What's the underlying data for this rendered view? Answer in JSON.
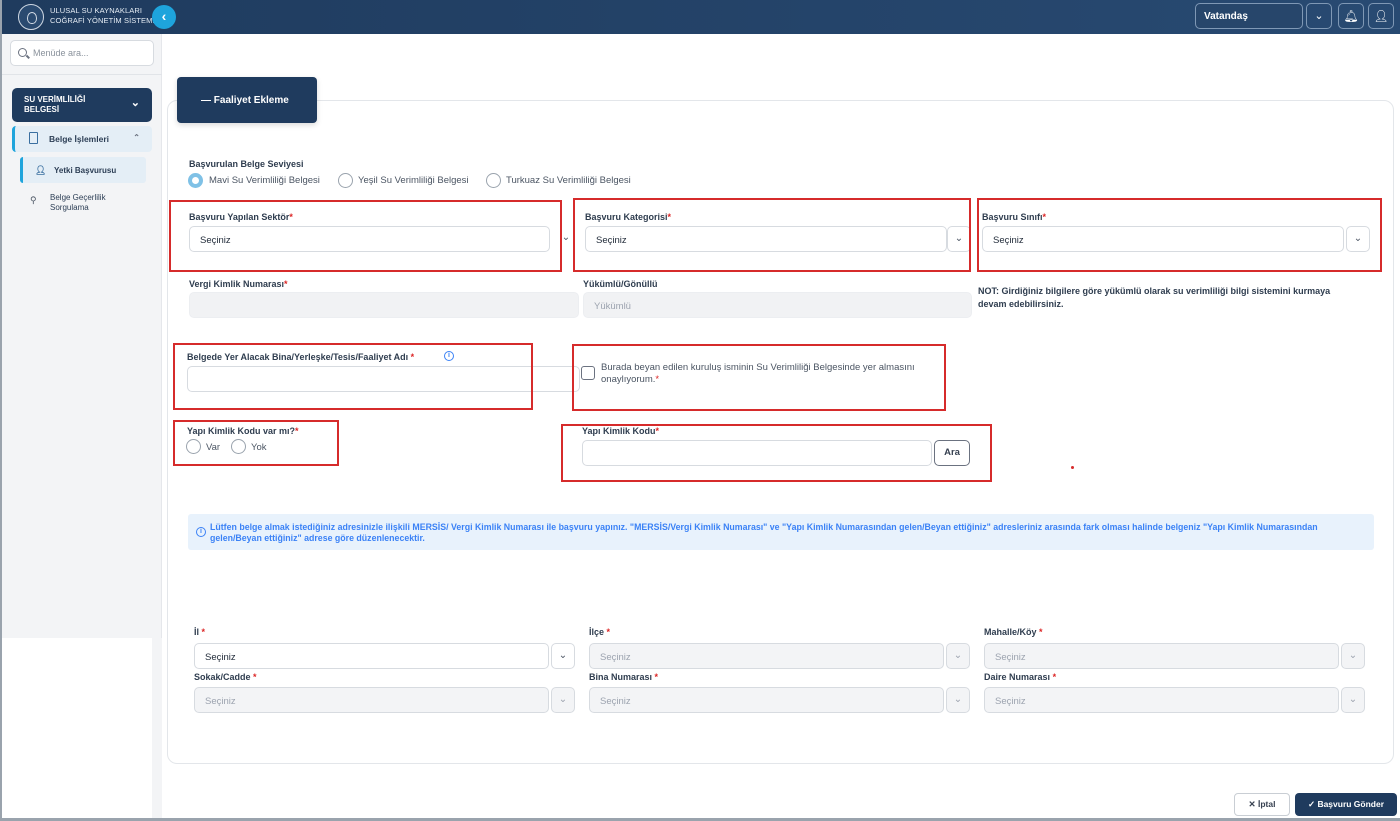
{
  "header": {
    "brand_line1": "ULUSAL SU KAYNAKLARI",
    "brand_line2": "COĞRAFİ YÖNETİM SİSTEMİ",
    "role": "Vatandaş"
  },
  "sidebar": {
    "search_placeholder": "Menüde ara...",
    "main_menu_line1": "SU VERİMLİLİĞİ",
    "main_menu_line2": "BELGESİ",
    "sub_menu": "Belge İşlemleri",
    "items": [
      {
        "label": "Yetki Başvurusu"
      },
      {
        "label_line1": "Belge Geçerlilik",
        "label_line2": "Sorgulama"
      }
    ]
  },
  "form": {
    "tab_title": "— Faaliyet Ekleme",
    "belge_seviyesi_label": "Başvurulan Belge Seviyesi",
    "belge_options": [
      "Mavi Su Verimliliği Belgesi",
      "Yeşil Su Verimliliği Belgesi",
      "Turkuaz Su Verimliliği Belgesi"
    ],
    "sektor_label": "Başvuru Yapılan Sektör",
    "kategori_label": "Başvuru Kategorisi",
    "sinif_label": "Başvuru Sınıfı",
    "select_default": "Seçiniz",
    "vkn_label": "Vergi Kimlik Numarası",
    "yukumlu_label": "Yükümlü/Gönüllü",
    "yukumlu_value": "Yükümlü",
    "note": "NOT: Girdiğiniz bilgilere göre yükümlü olarak su verimliliği bilgi sistemini kurmaya devam edebilirsiniz.",
    "bina_label": "Belgede Yer Alacak Bina/Yerleşke/Tesis/Faaliyet Adı",
    "onay_text": "Burada beyan edilen kuruluş isminin Su Verimliliği Belgesinde yer almasını onaylıyorum.",
    "ykk_var_label": "Yapı Kimlik Kodu var mı?",
    "var": "Var",
    "yok": "Yok",
    "ykk_label": "Yapı Kimlik Kodu",
    "ara": "Ara",
    "info_text": "Lütfen belge almak istediğiniz adresinizle ilişkili MERSİS/ Vergi Kimlik Numarası ile başvuru yapınız. \"MERSİS/Vergi Kimlik Numarası\" ve \"Yapı Kimlik Numarasından gelen/Beyan ettiğiniz\" adresleriniz arasında fark olması halinde belgeniz \"Yapı Kimlik Numarasından gelen/Beyan ettiğiniz\" adrese göre düzenlenecektir.",
    "address": {
      "il": "İl",
      "ilce": "İlçe",
      "mahalle": "Mahalle/Köy",
      "sokak": "Sokak/Cadde",
      "bina_no": "Bina Numarası",
      "daire_no": "Daire Numarası"
    },
    "required_mark": "*"
  },
  "footer": {
    "cancel": "İptal",
    "submit": "Başvuru Gönder"
  }
}
